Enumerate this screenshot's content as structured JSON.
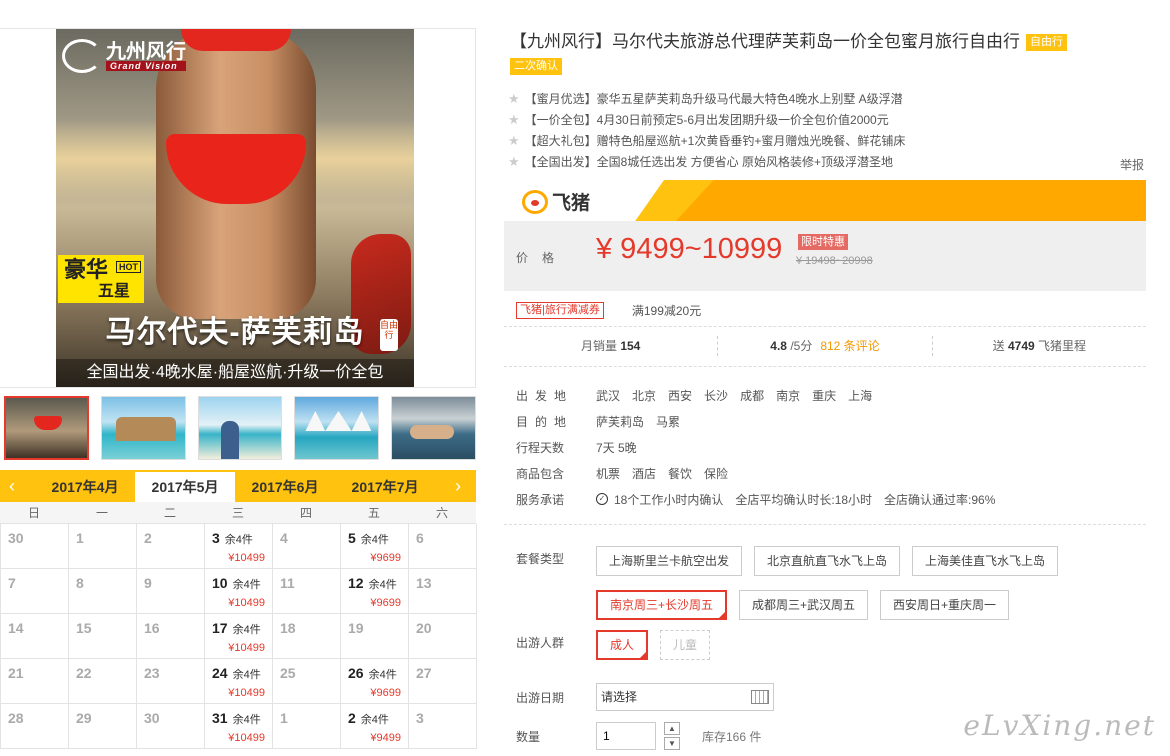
{
  "gallery": {
    "main_image": {
      "brand_cn": "九州风行",
      "brand_en": "Grand Vision",
      "badge_main": "豪华",
      "badge_hot": "HOT",
      "badge_sub": "五星",
      "title": "马尔代夫-萨芙莉岛",
      "side_tag": "自由行",
      "subtitle": "全国出发·4晚水屋·船屋巡航·升级一价全包"
    },
    "thumbnails": 5
  },
  "calendar": {
    "months": [
      "2017年4月",
      "2017年5月",
      "2017年6月",
      "2017年7月"
    ],
    "active_month": 1,
    "weekdays": [
      "日",
      "一",
      "二",
      "三",
      "四",
      "五",
      "六"
    ],
    "cells": [
      {
        "d": "30"
      },
      {
        "d": "1"
      },
      {
        "d": "2"
      },
      {
        "d": "3",
        "rem": "余4件",
        "price": "¥10499"
      },
      {
        "d": "4"
      },
      {
        "d": "5",
        "rem": "余4件",
        "price": "¥9699"
      },
      {
        "d": "6"
      },
      {
        "d": "7"
      },
      {
        "d": "8"
      },
      {
        "d": "9"
      },
      {
        "d": "10",
        "rem": "余4件",
        "price": "¥10499"
      },
      {
        "d": "11"
      },
      {
        "d": "12",
        "rem": "余4件",
        "price": "¥9699"
      },
      {
        "d": "13"
      },
      {
        "d": "14"
      },
      {
        "d": "15"
      },
      {
        "d": "16"
      },
      {
        "d": "17",
        "rem": "余4件",
        "price": "¥10499"
      },
      {
        "d": "18"
      },
      {
        "d": "19"
      },
      {
        "d": "20"
      },
      {
        "d": "21"
      },
      {
        "d": "22"
      },
      {
        "d": "23"
      },
      {
        "d": "24",
        "rem": "余4件",
        "price": "¥10499"
      },
      {
        "d": "25"
      },
      {
        "d": "26",
        "rem": "余4件",
        "price": "¥9699"
      },
      {
        "d": "27"
      },
      {
        "d": "28"
      },
      {
        "d": "29"
      },
      {
        "d": "30"
      },
      {
        "d": "31",
        "rem": "余4件",
        "price": "¥10499"
      },
      {
        "d": "1"
      },
      {
        "d": "2",
        "rem": "余4件",
        "price": "¥9499"
      },
      {
        "d": "3"
      }
    ]
  },
  "product": {
    "title": "【九州风行】马尔代夫旅游总代理萨芙莉岛一价全包蜜月旅行自由行",
    "chip1": "自由行",
    "chip2": "二次确认",
    "features": [
      "【蜜月优选】豪华五星萨芙莉岛升级马代最大特色4晚水上别墅 A级浮潜",
      "【一价全包】4月30日前预定5-6月出发团期升级一价全包价值2000元",
      "【超大礼包】赠特色船屋巡航+1次黄昏垂钓+蜜月赠烛光晚餐、鲜花铺床",
      "【全国出发】全国8城任选出发 方便省心 原始风格装修+顶级浮潜圣地"
    ],
    "report": "举报",
    "platform": "飞猪",
    "price_label": "价格",
    "price": "¥ 9499~10999",
    "limited_tag": "限时特惠",
    "old_price": "¥ 19498~20998",
    "promo_tag": "飞猪|旅行满减券",
    "promo_text": "满199减20元",
    "stats": {
      "monthly_label": "月销量",
      "monthly": "154",
      "rating": "4.8",
      "rating_unit": "/5分",
      "reviews": "812 条评论",
      "gift_prefix": "送",
      "miles": "4749",
      "gift_suffix": "飞猪里程"
    },
    "attrs": {
      "depart_label": "出发地",
      "depart": [
        "武汉",
        "北京",
        "西安",
        "长沙",
        "成都",
        "南京",
        "重庆",
        "上海"
      ],
      "dest_label": "目的地",
      "dest": [
        "萨芙莉岛",
        "马累"
      ],
      "days_label": "行程天数",
      "days": "7天 5晚",
      "includes_label": "商品包含",
      "includes": [
        "机票",
        "酒店",
        "餐饮",
        "保险"
      ],
      "service_label": "服务承诺",
      "service": [
        "18个工作小时内确认",
        "全店平均确认时长:18小时",
        "全店确认通过率:96%"
      ]
    },
    "options": {
      "package_label": "套餐类型",
      "packages": [
        "上海斯里兰卡航空出发",
        "北京直航直飞水飞上岛",
        "上海美佳直飞水飞上岛",
        "南京周三+长沙周五",
        "成都周三+武汉周五",
        "西安周日+重庆周一"
      ],
      "package_selected": 3,
      "crowd_label": "出游人群",
      "crowd": [
        "成人",
        "儿童"
      ],
      "date_label": "出游日期",
      "date_value": "请选择",
      "qty_label": "数量",
      "qty_value": "1",
      "stock": "库存166 件"
    }
  },
  "watermark": "eLvXing.net"
}
